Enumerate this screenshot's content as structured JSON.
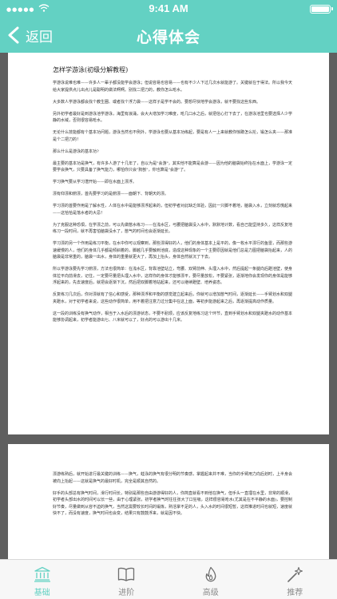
{
  "status_bar": {
    "time": "9:41 AM",
    "signal": "●●●●●"
  },
  "nav": {
    "back_label": "返回",
    "title": "心得体会"
  },
  "document": {
    "page1": {
      "title": "怎样学游泳(初级分解教程)",
      "paragraphs": [
        "学游泳说难也难——许多人一辈子都没能学会游泳；但说容易也容易——也有不少人下过几次水就能游了。关键就在于得法。所以我今天给大家提供点儿出点儿是聪明的做法啊啊。别找二把刀的，教你怎么呛水。",
        "大多数人学游泳都会找个教生圈、或者找个浮力袋——这样子是学不会的。要想尽快地学会游泳，就不要找这些东西。",
        "另外初学者最好是到游泳池学游泳，海里有浪涌，会大大增加学习难度，呛几口水之后，就把信心打下去了，在游泳池里也要选择人少学静的水域，否则很容易呛水。",
        "无论什么技能都有个基本功问题，游泳当然也不例外，学游泳也要从基本功练起，要是有人一上来就教你惊蹲怎么抡，锻怎么夹——那准是个二把刀的！",
        "那么什么是游泳的基本功?",
        "最主要的基本功是换气，有许多人游了十几年了，自以为是\"会游\"，其实他不能算是会游——因为他的脑袋始终抬在水面上，学游泳一定要学会换气，只要具备了换气能力，哪怕你只会\"狗刨\"，你也算是\"会游\"了。",
        "学习换气要从学习潜开始——即在水面上漂浮。",
        "漂有仰漂和俯漂，首先要学习的是俯漂——面朝下、背朝天的漂。",
        "学习漂的首要作用是了解水性，人体在水中是能够漂浮起来的，但初学者对此缺乏体验，因此一只脚不着地，脑袋入水，立刻就恐慌起来——这恰恰是落水者的大忌！",
        "为了克服这种恐惧，在学漂之前，可以先做憋水练习——在浅水区，弓腰把脑袋没入水中，默默地计数，看自己能坚持多久，这样反复地练习一段时间，就不再害怕脑袋没水了，憋气的时间也会逐渐延长。",
        "学习漂的另一个作用是练习平衡，在水中你可以观察到，那些漂得好的人，他们的身体基本上是平的，像一枚水平漂行的鱼雷，而那些游速缓慢的人，他们的身体几乎都是倾斜着的，脚越几乎要触到池底，造成这种现象的一个主要原因就是他们总是力图把脑袋抬起来，人的脑袋是非常重的，脑袋一出水，身体的重量就更大了，再加上抬头，身体自然就沉了下去。",
        "所以学游泳要先学习俯漂，方法也很简单：在浅水区，背靠池壁站立，弯腰、双臂前伸、头埋入水中，然后提起一条腿向后蹬池壁，使身体拉平向前滑去，记住，一定要尽量把头埋入水中，这样你的身体才能够漂平，要尽量放松，不要紧张，逐渐地你会发现你的身体是能够浮起来的，先去速度后，就把会逐渐下沉，然后把双脚着地站起来，还可以继续蹬壁、培养姿态。",
        "反复练习几次后，你对漂就有了信心和感受，那种漂浮和平衡的感觉建立起来后，你就可以增加憋气时间，逐渐延长——手臂划水和双腿夹蹬水，对于初学者来说，这些动作很简单，用不着把注意力过分集中在这上面，等初步能游起来之后，再逐渐提高动作质量。",
        "这一段的训练没有换气动作，相当于入水后的漂游状态，不要不耐烦，应该反复地练习这个环节，直到手臂划水和双腿夹蹬水的动作基本能够协调起来，初学者能游出七、八米就可以了，好点的可以游出十几米。"
      ]
    },
    "page2": {
      "paragraphs": [
        "漂游练熟后，就开始进行最关键的训练——换气，蛙泳的换气有很分明的节奏感，掌握起来并不难，当你的手臂用力向后划时，上半身会被向上抬起——这就是换气的最好时机，完全是顺其自然的。",
        "好手的头部总有换气时间，滑行时间长，特别是那些自由游游得好的人，你简直就看不到他在换气，但手头一直埋在水里，非常的顺滑，初学者头部出水的时间可以长一些，由于心理紧张，初学者换气时往往张大了口狂吸，这样很容易呛水(尤其是在不平静的水面)，要控制好节奏，尽量做到从容不迫的换气，当然这需要较长时间的锻炼，熟活掌不足的人，头入水的时间很短暂，这样推进时间也就短，速度就快不了，而没有速度，换气时间也会变，结果只有鼓鼓浮来，就是因不快。"
      ]
    }
  },
  "tabs": [
    {
      "label": "基础",
      "icon": "bank-icon",
      "active": true
    },
    {
      "label": "进阶",
      "icon": "book-icon",
      "active": false
    },
    {
      "label": "高级",
      "icon": "flame-icon",
      "active": false
    },
    {
      "label": "推荐",
      "icon": "magic-wand-icon",
      "active": false
    }
  ],
  "colors": {
    "accent": "#63d1c3",
    "content_bg": "#5f5f5f",
    "tab_inactive": "#8c8c8c"
  }
}
